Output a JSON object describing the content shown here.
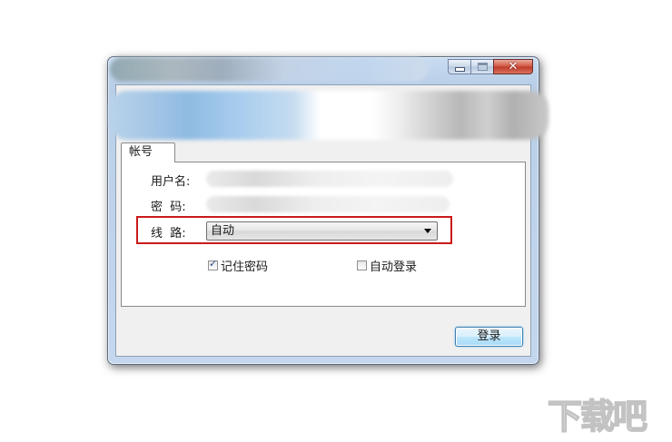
{
  "dialog": {
    "caption_buttons": {
      "minimize_icon": "minimize-icon",
      "maximize_icon": "maximize-icon",
      "close_icon": "close-icon",
      "close_glyph": "✕"
    },
    "tab_label": "帐号",
    "username_label": "用户名:",
    "password_label": "密  码:",
    "route_label": "线  路:",
    "route_select_value": "自动",
    "remember_password": {
      "label": "记住密码",
      "checked": true
    },
    "auto_login": {
      "label": "自动登录",
      "checked": false
    },
    "login_button": "登录",
    "highlight_color": "#cc1a1a"
  },
  "watermark": {
    "text": "下载吧"
  }
}
